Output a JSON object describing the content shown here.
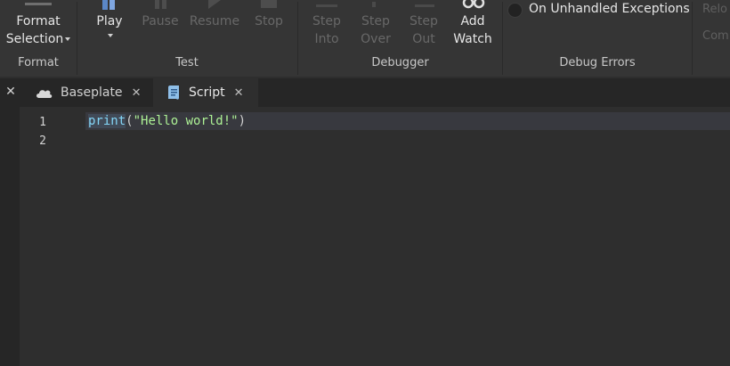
{
  "ribbon": {
    "format": {
      "group_label": "Format",
      "format_selection": {
        "line1": "Format",
        "line2": "Selection"
      }
    },
    "test": {
      "group_label": "Test",
      "play": "Play",
      "pause": "Pause",
      "resume": "Resume",
      "stop": "Stop"
    },
    "debugger": {
      "group_label": "Debugger",
      "step_into": {
        "line1": "Step",
        "line2": "Into"
      },
      "step_over": {
        "line1": "Step",
        "line2": "Over"
      },
      "step_out": {
        "line1": "Step",
        "line2": "Out"
      },
      "add_watch": {
        "line1": "Add",
        "line2": "Watch"
      }
    },
    "debug_errors": {
      "group_label": "Debug Errors",
      "on_unhandled": "On Unhandled Exceptions"
    },
    "partial": {
      "line1": "Relo",
      "line2": "Com"
    }
  },
  "tabs": {
    "close_glyph": "✕",
    "items": [
      {
        "label": "Baseplate",
        "close": "✕",
        "icon": "cloud-icon"
      },
      {
        "label": "Script",
        "close": "✕",
        "icon": "script-icon"
      }
    ]
  },
  "editor": {
    "line_numbers": [
      "1",
      "2"
    ],
    "code": {
      "fn": "print",
      "open": "(",
      "str": "\"Hello world!\"",
      "close": ")"
    }
  },
  "colors": {
    "ribbon_bg": "#353535",
    "editor_bg": "#2e2e2e",
    "keyword_blue": "#84d6f7",
    "string_green": "#adf195"
  }
}
